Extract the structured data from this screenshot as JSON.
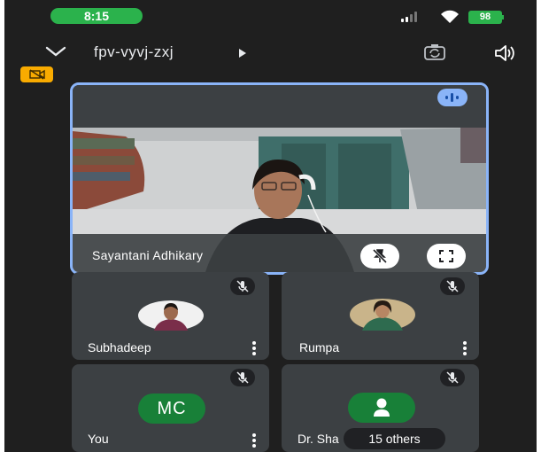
{
  "status_bar": {
    "time": "8:15",
    "battery": "98"
  },
  "header": {
    "meeting_code": "fpv-vyvj-zxj"
  },
  "main_tile": {
    "name": "Sayantani Adhikary"
  },
  "tiles": [
    {
      "name": "Subhadeep"
    },
    {
      "name": "Rumpa"
    },
    {
      "name": "You",
      "initials": "MC"
    },
    {
      "name": "Dr. Sha"
    }
  ],
  "others_chip": {
    "label": "15 others"
  },
  "colors": {
    "accent_green": "#2bb24c",
    "tile_bg": "#3c4043",
    "active_border": "#8ab4f8",
    "avatar_green": "#188038"
  }
}
